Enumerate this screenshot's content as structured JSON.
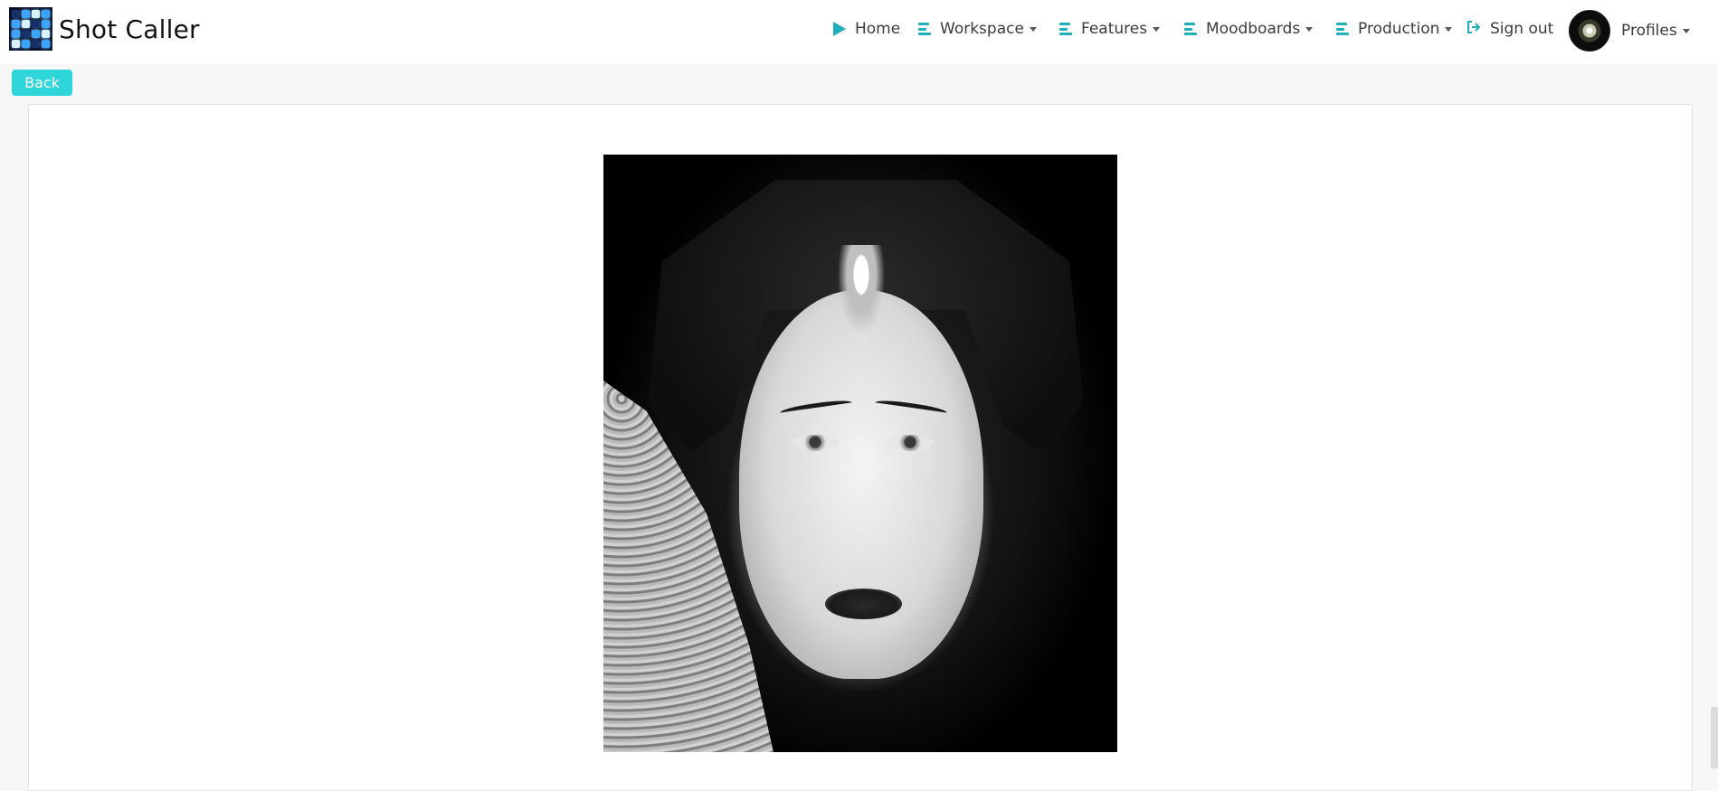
{
  "brand": {
    "name": "Shot Caller"
  },
  "nav": {
    "home": "Home",
    "workspace": "Workspace",
    "features": "Features",
    "moodboards": "Moodboards",
    "production": "Production",
    "sign_out": "Sign out",
    "profiles": "Profiles"
  },
  "back_button": "Back",
  "colors": {
    "accent": "#1fb0b8",
    "back_button": "#2fd6d9",
    "nav_text": "#3b3b3b",
    "page_bg": "#f7f7f7"
  },
  "icons": {
    "brand": "shot-caller-logo-icon",
    "home": "play-icon",
    "menu": "bars-icon",
    "sign_out": "sign-out-icon",
    "profile": "avatar"
  },
  "image": {
    "subject": "black-and-white portrait photograph"
  }
}
